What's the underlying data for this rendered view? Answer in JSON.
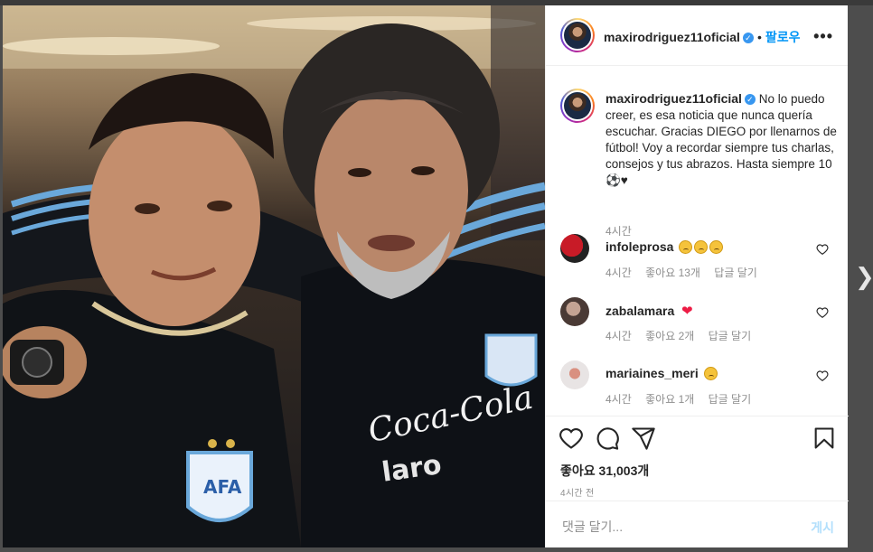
{
  "post": {
    "username": "maxirodriguez11oficial",
    "verified": true,
    "follow_label": "팔로우",
    "more_icon": "more-icon",
    "caption": "No lo puedo creer, es esa noticia que nunca quería escuchar. Gracias DIEGO por llenarnos de fútbol! Voy a recordar siempre tus charlas, consejos y tus abrazos. Hasta siempre 10 ⚽♥",
    "caption_time": "4시간"
  },
  "comments": [
    {
      "username": "infoleprosa",
      "emoji": [
        "sad",
        "sad",
        "sad"
      ],
      "time": "4시간",
      "likes": "좋아요 13개",
      "reply": "답글 달기",
      "avatar_color": "#c81b27"
    },
    {
      "username": "zabalamara",
      "emoji": [
        "red-heart"
      ],
      "time": "4시간",
      "likes": "좋아요 2개",
      "reply": "답글 달기",
      "avatar_color": "#8a7a72"
    },
    {
      "username": "mariaines_meri",
      "emoji": [
        "sad"
      ],
      "time": "4시간",
      "likes": "좋아요 1개",
      "reply": "답글 달기",
      "avatar_color": "#d9d2d2"
    }
  ],
  "actions": {
    "likes_count": "좋아요 31,003개",
    "posted_ago": "4시간 전",
    "comment_placeholder": "댓글 달기...",
    "post_label": "게시"
  },
  "colors": {
    "link_blue": "#0095f6",
    "verified_blue": "#3897f0",
    "muted_gray": "#8e8e8e",
    "post_disabled": "#b2dffc"
  }
}
